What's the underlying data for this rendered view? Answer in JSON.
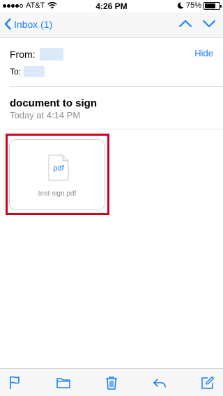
{
  "status_bar": {
    "carrier": "AT&T",
    "time": "4:26 PM",
    "battery": "75%",
    "battery_level": 0.75,
    "signal_bars": 4
  },
  "nav": {
    "back_label": "Inbox (1)",
    "icons": [
      "chevron-left-icon",
      "chevron-up-icon",
      "chevron-down-icon"
    ]
  },
  "header": {
    "from_label": "From:",
    "to_label": "To:",
    "hide_label": "Hide"
  },
  "message": {
    "subject": "document to sign",
    "date": "Today at 4:14 PM"
  },
  "attachment": {
    "type_label": "pdf",
    "filename": "test-sign.pdf"
  },
  "toolbar": {
    "icons": [
      "flag-icon",
      "folder-icon",
      "trash-icon",
      "reply-icon",
      "compose-icon"
    ]
  },
  "colors": {
    "accent": "#147efb",
    "highlight": "#d0021b",
    "secondary_text": "#8e8e93",
    "bar_background": "#f7f7f7"
  }
}
